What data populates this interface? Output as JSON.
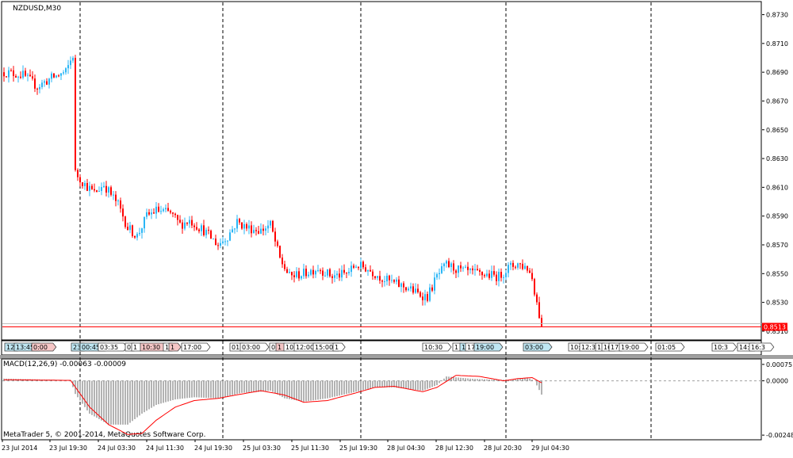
{
  "window": {
    "symbol_label": "NZDUSD,M30"
  },
  "colors": {
    "bull": "#29b6f6",
    "bear": "#ff0000",
    "signal": "#ff0000",
    "hist": "#808080",
    "grid": "#000000",
    "price_line": "#ff0000",
    "price_tag_bg": "#ff0000"
  },
  "main_axis": {
    "ticks": [
      "0.8730",
      "0.8710",
      "0.8690",
      "0.8670",
      "0.8650",
      "0.8630",
      "0.8610",
      "0.8590",
      "0.8570",
      "0.8550",
      "0.8530",
      "0.8510"
    ],
    "current_price": "0.8513",
    "ylim": [
      0.8505,
      0.8738
    ]
  },
  "macd": {
    "label": "MACD(12,26,9) -0.00063 -0.00009",
    "ticks": [
      "0.00075",
      "0.0000",
      "-0.00248"
    ],
    "ylim": [
      -0.00262,
      0.00089
    ]
  },
  "footer": {
    "copyright": "MetaTrader 5, © 2001-2014, MetaQuotes Software Corp."
  },
  "time_axis": [
    "23 Jul 2014",
    "23 Jul 19:30",
    "24 Jul 03:30",
    "24 Jul 11:30",
    "24 Jul 19:30",
    "25 Jul 03:30",
    "25 Jul 11:30",
    "25 Jul 19:30",
    "28 Jul 04:30",
    "28 Jul 12:30",
    "28 Jul 20:30",
    "29 Jul 04:30"
  ],
  "events": [
    {
      "label": "12",
      "c": "b"
    },
    {
      "label": "13:45",
      "c": "b"
    },
    {
      "label": "0:00",
      "c": "r"
    },
    {
      "label": "23",
      "c": "b"
    },
    {
      "label": "00:45",
      "c": "b"
    },
    {
      "label": "03:35",
      "c": "w"
    },
    {
      "label": "0",
      "c": "w"
    },
    {
      "label": "1",
      "c": "w"
    },
    {
      "label": "10:30",
      "c": "r"
    },
    {
      "label": "1",
      "c": "w"
    },
    {
      "label": "1",
      "c": "r"
    },
    {
      "label": "17:00",
      "c": "w"
    },
    {
      "label": "01",
      "c": "w"
    },
    {
      "label": "03:00",
      "c": "w"
    },
    {
      "label": "0",
      "c": "w"
    },
    {
      "label": "1",
      "c": "r"
    },
    {
      "label": "10",
      "c": "w"
    },
    {
      "label": "12:00",
      "c": "w"
    },
    {
      "label": "15:00",
      "c": "w"
    },
    {
      "label": "1",
      "c": "w"
    },
    {
      "label": "10:30",
      "c": "w"
    },
    {
      "label": "1",
      "c": "w"
    },
    {
      "label": "1",
      "c": "b"
    },
    {
      "label": "17",
      "c": "w"
    },
    {
      "label": "19:00",
      "c": "b"
    },
    {
      "label": "03:00",
      "c": "b"
    },
    {
      "label": "10:30",
      "c": "w"
    },
    {
      "label": "12:3",
      "c": "w"
    },
    {
      "label": "1",
      "c": "w"
    },
    {
      "label": "16",
      "c": "w"
    },
    {
      "label": "17",
      "c": "w"
    },
    {
      "label": "19:00",
      "c": "w"
    },
    {
      "label": "01:05",
      "c": "w"
    },
    {
      "label": "10:3",
      "c": "w"
    },
    {
      "label": "14:",
      "c": "w"
    },
    {
      "label": "16:3",
      "c": "w"
    }
  ],
  "chart_data": [
    {
      "type": "candlestick",
      "title": "NZDUSD,M30",
      "ylim": [
        0.8505,
        0.8738
      ],
      "close_anchors": [
        [
          0,
          0.869
        ],
        [
          8,
          0.8688
        ],
        [
          14,
          0.868
        ],
        [
          20,
          0.8686
        ],
        [
          26,
          0.869
        ],
        [
          29,
          0.8702
        ],
        [
          30,
          0.862
        ],
        [
          34,
          0.8612
        ],
        [
          38,
          0.8606
        ],
        [
          42,
          0.8612
        ],
        [
          48,
          0.8598
        ],
        [
          52,
          0.8582
        ],
        [
          56,
          0.8576
        ],
        [
          60,
          0.859
        ],
        [
          64,
          0.8594
        ],
        [
          70,
          0.8592
        ],
        [
          74,
          0.8584
        ],
        [
          78,
          0.8587
        ],
        [
          84,
          0.858
        ],
        [
          90,
          0.857
        ],
        [
          94,
          0.8576
        ],
        [
          98,
          0.8586
        ],
        [
          102,
          0.8582
        ],
        [
          108,
          0.858
        ],
        [
          112,
          0.8584
        ],
        [
          116,
          0.856
        ],
        [
          120,
          0.8548
        ],
        [
          126,
          0.855
        ],
        [
          132,
          0.8554
        ],
        [
          138,
          0.8548
        ],
        [
          144,
          0.855
        ],
        [
          148,
          0.8556
        ],
        [
          152,
          0.8554
        ],
        [
          156,
          0.855
        ],
        [
          160,
          0.8546
        ],
        [
          166,
          0.8542
        ],
        [
          170,
          0.854
        ],
        [
          174,
          0.8536
        ],
        [
          178,
          0.8534
        ],
        [
          182,
          0.8548
        ],
        [
          186,
          0.8556
        ],
        [
          192,
          0.8552
        ],
        [
          198,
          0.855
        ],
        [
          204,
          0.8549
        ],
        [
          208,
          0.8548
        ],
        [
          212,
          0.8554
        ],
        [
          216,
          0.8557
        ],
        [
          220,
          0.8554
        ],
        [
          222,
          0.8547
        ],
        [
          224,
          0.853
        ],
        [
          226,
          0.8513
        ]
      ]
    },
    {
      "type": "bar",
      "title": "MACD(12,26,9)",
      "ylim": [
        -0.00262,
        0.00089
      ],
      "macd_anchors": [
        [
          0,
          0.0001
        ],
        [
          20,
          5e-05
        ],
        [
          28,
          2e-05
        ],
        [
          30,
          -0.0006
        ],
        [
          36,
          -0.0015
        ],
        [
          44,
          -0.002
        ],
        [
          52,
          -0.002
        ],
        [
          58,
          -0.0015
        ],
        [
          64,
          -0.0011
        ],
        [
          72,
          -0.00085
        ],
        [
          80,
          -0.00075
        ],
        [
          90,
          -0.0008
        ],
        [
          100,
          -0.00055
        ],
        [
          108,
          -0.0005
        ],
        [
          112,
          -0.00045
        ],
        [
          118,
          -0.0008
        ],
        [
          126,
          -0.00095
        ],
        [
          136,
          -0.0008
        ],
        [
          148,
          -0.0005
        ],
        [
          156,
          -0.0003
        ],
        [
          164,
          -0.0003
        ],
        [
          176,
          -0.00045
        ],
        [
          182,
          -0.0002
        ],
        [
          186,
          0.0002
        ],
        [
          196,
          0.0001
        ],
        [
          206,
          5e-05
        ],
        [
          214,
          5e-05
        ],
        [
          220,
          0.00015
        ],
        [
          223,
          0.0
        ],
        [
          226,
          -0.00063
        ]
      ],
      "signal_anchors": [
        [
          0,
          5e-05
        ],
        [
          28,
          2e-05
        ],
        [
          36,
          -0.0012
        ],
        [
          44,
          -0.002
        ],
        [
          52,
          -0.00245
        ],
        [
          58,
          -0.0024
        ],
        [
          64,
          -0.0018
        ],
        [
          72,
          -0.0012
        ],
        [
          80,
          -0.0009
        ],
        [
          90,
          -0.0008
        ],
        [
          100,
          -0.0006
        ],
        [
          108,
          -0.00045
        ],
        [
          118,
          -0.00065
        ],
        [
          126,
          -0.00098
        ],
        [
          136,
          -0.0009
        ],
        [
          148,
          -0.00055
        ],
        [
          156,
          -0.0003
        ],
        [
          164,
          -0.00025
        ],
        [
          176,
          -0.0005
        ],
        [
          182,
          -0.0003
        ],
        [
          190,
          0.00025
        ],
        [
          200,
          0.0002
        ],
        [
          210,
          0.0
        ],
        [
          216,
          0.0001
        ],
        [
          222,
          0.00015
        ],
        [
          226,
          -9e-05
        ]
      ]
    }
  ]
}
